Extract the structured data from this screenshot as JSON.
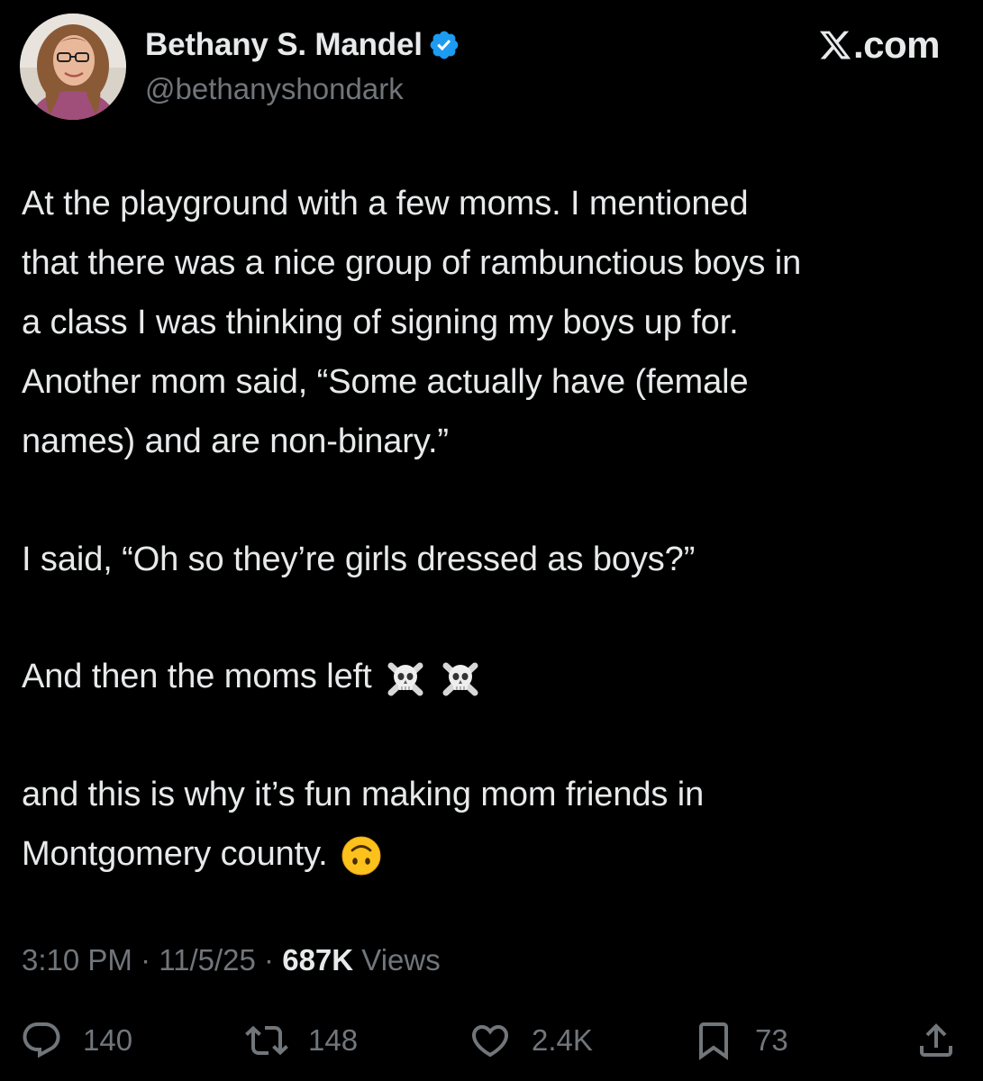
{
  "author": {
    "display_name": "Bethany S. Mandel",
    "handle": "@bethanyshondark",
    "verified_color": "#1d9bf0"
  },
  "brand": {
    "label": ".com",
    "icon": "x-logo-icon"
  },
  "tweet": {
    "lines": [
      "At the playground with a few moms. I mentioned",
      "that there was a nice group of rambunctious boys in",
      "a class I was thinking of signing my boys up for.",
      "Another mom said, “Some actually have (female",
      "names) and are non-binary.”",
      "I said, “Oh so they’re girls dressed as boys?”",
      "And then the moms left",
      "and this is why it’s fun making mom friends in",
      "Montgomery county."
    ],
    "emojis": [
      "skull-crossbones-emoji",
      "skull-crossbones-emoji",
      "upside-down-face-emoji"
    ]
  },
  "meta": {
    "time": "3:10 PM",
    "separator": " · ",
    "date": "11/5/25",
    "views_count": "687K",
    "views_label": " Views"
  },
  "actions": {
    "replies": "140",
    "reposts": "148",
    "likes": "2.4K",
    "bookmarks": "73"
  },
  "colors": {
    "background": "#000000",
    "text": "#e7e9ea",
    "secondary": "#71767b",
    "accent": "#1d9bf0"
  }
}
